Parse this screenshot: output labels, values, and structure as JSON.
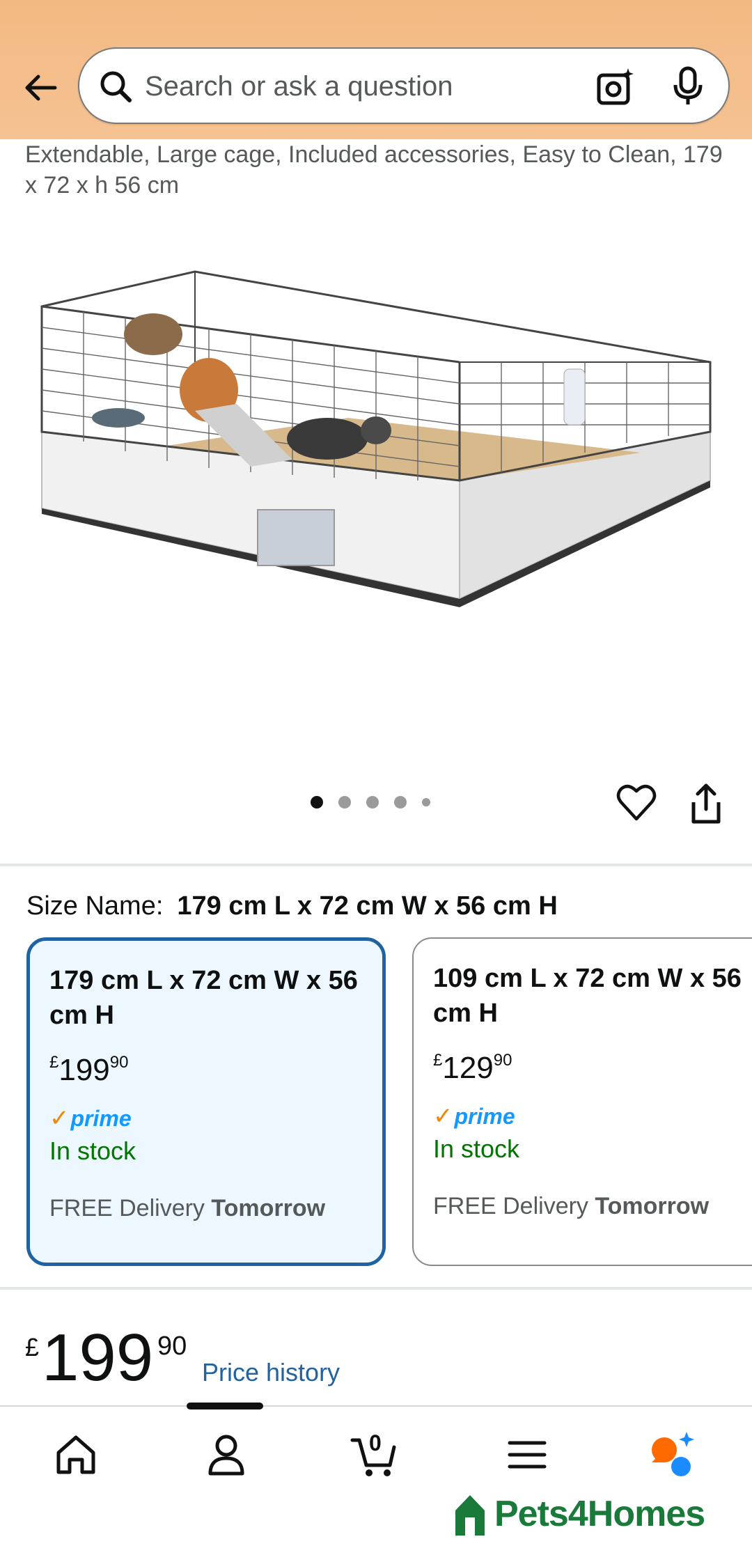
{
  "header": {
    "search_placeholder": "Search or ask a question"
  },
  "product": {
    "title_fragment": "Extendable, Large cage, Included accessories, Easy to Clean, 179 x 72 x h 56 cm",
    "image_count": 5,
    "active_image_index": 0
  },
  "size": {
    "label": "Size Name:",
    "selected": "179 cm L x 72 cm W x 56 cm H",
    "options": [
      {
        "title": "179 cm L x 72 cm W x 56 cm H",
        "currency": "£",
        "price_whole": "199",
        "price_fraction": "90",
        "prime": "prime",
        "stock": "In stock",
        "delivery_prefix": "FREE Delivery",
        "delivery_day": "Tomorrow"
      },
      {
        "title": "109 cm L x 72 cm W x 56 cm H",
        "currency": "£",
        "price_whole": "129",
        "price_fraction": "90",
        "prime": "prime",
        "stock": "In stock",
        "delivery_prefix": "FREE Delivery",
        "delivery_day": "Tomorrow"
      }
    ]
  },
  "price": {
    "currency": "£",
    "whole": "199",
    "fraction": "90",
    "history_link": "Price history"
  },
  "nav": {
    "cart_count": "0",
    "brand": "Pets4Homes"
  },
  "colors": {
    "header_bg": "#f3b983",
    "link": "#2162a1",
    "in_stock": "#007600",
    "prime_blue": "#1399ff",
    "brand_green": "#1a7a3a"
  }
}
